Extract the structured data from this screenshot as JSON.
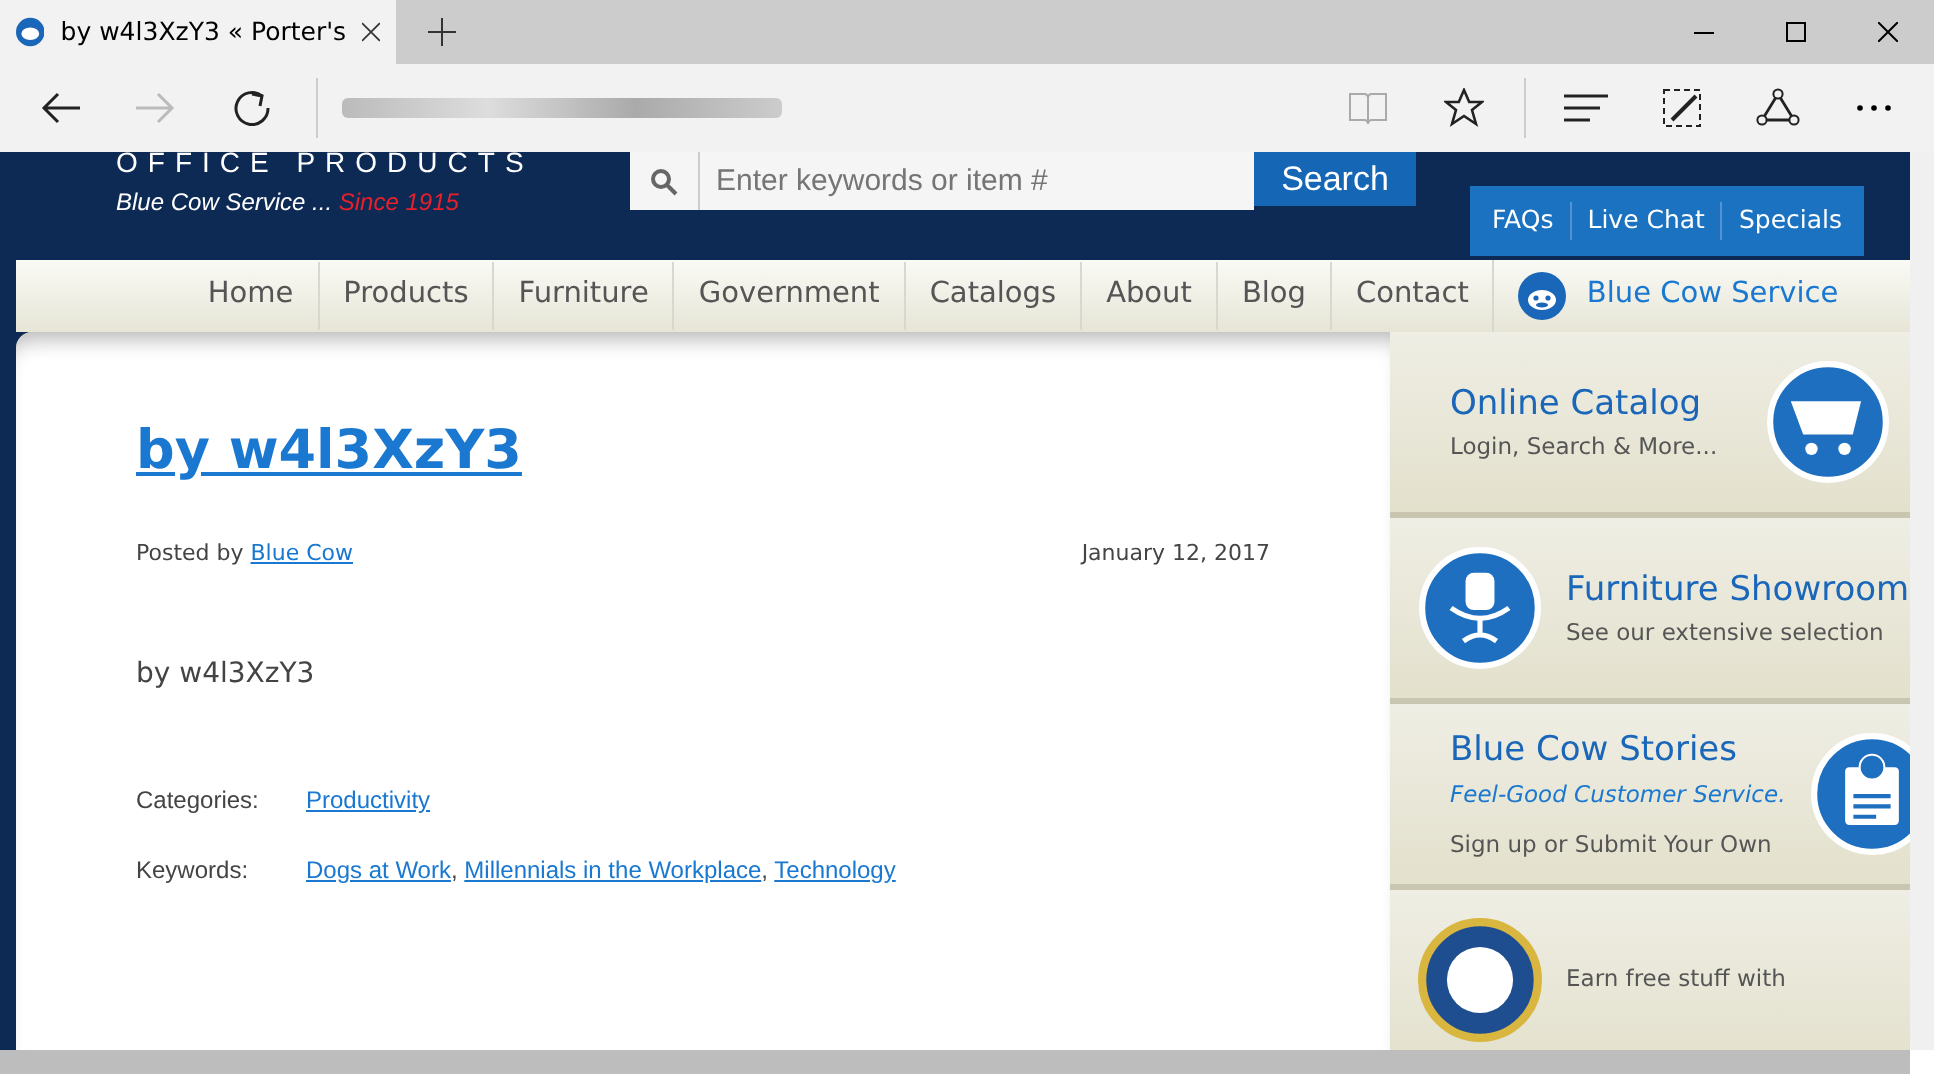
{
  "browser": {
    "tab_title": "by w4l3XzY3 « Porter's",
    "forward_disabled": true
  },
  "header": {
    "brand": "OFFICE PRODUCTS",
    "tagline": "Blue Cow Service ...",
    "tagline_since": "Since 1915",
    "search": {
      "placeholder": "Enter keywords or item #",
      "button": "Search"
    },
    "top_links": [
      "FAQs",
      "Live Chat",
      "Specials"
    ]
  },
  "nav": [
    {
      "label": "Home",
      "kind": "link"
    },
    {
      "label": "Products",
      "kind": "link"
    },
    {
      "label": "Furniture",
      "kind": "link"
    },
    {
      "label": "Government",
      "kind": "link"
    },
    {
      "label": "Catalogs",
      "kind": "link"
    },
    {
      "label": "About",
      "kind": "link"
    },
    {
      "label": "Blog",
      "kind": "link"
    },
    {
      "label": "Contact",
      "kind": "link"
    },
    {
      "label": "Blue Cow Service",
      "kind": "brand"
    }
  ],
  "post": {
    "title": "by w4l3XzY3",
    "posted_by": "Posted by",
    "author": "Blue Cow",
    "date": "January 12, 2017",
    "body": "by w4l3XzY3",
    "meta": [
      {
        "label": "Categories:",
        "links": [
          "Productivity"
        ]
      },
      {
        "label": "Keywords:",
        "links": [
          "Dogs at Work",
          "Millennials in the Workplace",
          "Technology"
        ],
        "separator": ","
      }
    ]
  },
  "sidebar": [
    {
      "kind": "cart",
      "title": "Online Catalog",
      "subtitle": "Login, Search & More..."
    },
    {
      "kind": "chair",
      "title": "Furniture Showroom",
      "subtitle": "See our extensive selection"
    },
    {
      "kind": "clipboard",
      "title": "Blue Cow Stories",
      "tagline": "Feel-Good Customer Service.",
      "subtitle": "Sign up or Submit Your Own"
    },
    {
      "kind": "badge",
      "subtitle": "Earn free stuff with"
    }
  ]
}
